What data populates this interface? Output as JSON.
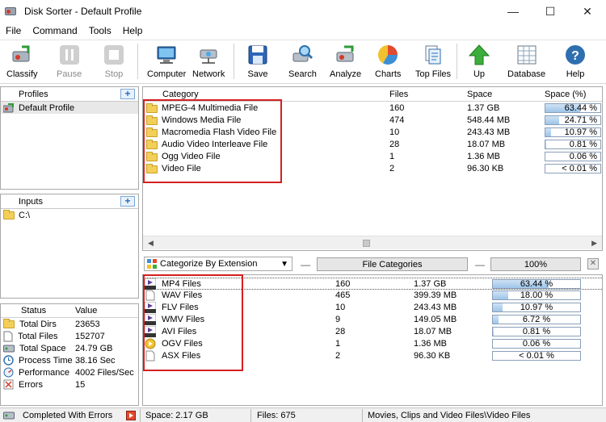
{
  "window": {
    "title": "Disk Sorter - Default Profile",
    "minimize": "—",
    "maximize": "☐",
    "close": "✕"
  },
  "menu": [
    "File",
    "Command",
    "Tools",
    "Help"
  ],
  "toolbar": {
    "classify": "Classify",
    "pause": "Pause",
    "stop": "Stop",
    "computer": "Computer",
    "network": "Network",
    "save": "Save",
    "search": "Search",
    "analyze": "Analyze",
    "charts": "Charts",
    "top_files": "Top Files",
    "up": "Up",
    "database": "Database",
    "help": "Help"
  },
  "profiles": {
    "header": "Profiles",
    "plus": "+",
    "items": [
      "Default Profile"
    ]
  },
  "inputs": {
    "header": "Inputs",
    "plus": "+",
    "items": [
      "C:\\"
    ]
  },
  "status": {
    "col_status": "Status",
    "col_value": "Value",
    "rows": [
      {
        "label": "Total Dirs",
        "value": "23653"
      },
      {
        "label": "Total Files",
        "value": "152707"
      },
      {
        "label": "Total Space",
        "value": "24.79 GB"
      },
      {
        "label": "Process Time",
        "value": "38.16 Sec"
      },
      {
        "label": "Performance",
        "value": "4002 Files/Sec"
      },
      {
        "label": "Errors",
        "value": "15"
      }
    ]
  },
  "top_grid": {
    "col_category": "Category",
    "col_files": "Files",
    "col_space": "Space",
    "col_space_pct": "Space (%)",
    "rows": [
      {
        "name": "MPEG-4 Multimedia File",
        "files": "160",
        "space": "1.37 GB",
        "pct_text": "63.44 %",
        "pct": 63.44
      },
      {
        "name": "Windows Media File",
        "files": "474",
        "space": "548.44 MB",
        "pct_text": "24.71 %",
        "pct": 24.71
      },
      {
        "name": "Macromedia Flash Video File",
        "files": "10",
        "space": "243.43 MB",
        "pct_text": "10.97 %",
        "pct": 10.97
      },
      {
        "name": "Audio Video Interleave File",
        "files": "28",
        "space": "18.07 MB",
        "pct_text": "0.81 %",
        "pct": 0.81
      },
      {
        "name": "Ogg Video File",
        "files": "1",
        "space": "1.36 MB",
        "pct_text": "0.06 %",
        "pct": 0.06
      },
      {
        "name": "Video File",
        "files": "2",
        "space": "96.30 KB",
        "pct_text": "< 0.01 %",
        "pct": 0.01
      }
    ]
  },
  "catbar": {
    "combo": "Categorize By Extension",
    "file_categories": "File Categories",
    "pct": "100%",
    "close": "✕"
  },
  "bottom_grid": {
    "rows": [
      {
        "name": "MP4 Files",
        "badge": "MP4",
        "files": "160",
        "space": "1.37 GB",
        "pct_text": "63.44 %",
        "pct": 63.44
      },
      {
        "name": "WAV Files",
        "badge": "",
        "files": "465",
        "space": "399.39 MB",
        "pct_text": "18.00 %",
        "pct": 18.0
      },
      {
        "name": "FLV Files",
        "badge": "FLV",
        "files": "10",
        "space": "243.43 MB",
        "pct_text": "10.97 %",
        "pct": 10.97
      },
      {
        "name": "WMV Files",
        "badge": "WMV",
        "files": "9",
        "space": "149.05 MB",
        "pct_text": "6.72 %",
        "pct": 6.72
      },
      {
        "name": "AVI Files",
        "badge": "AVI",
        "files": "28",
        "space": "18.07 MB",
        "pct_text": "0.81 %",
        "pct": 0.81
      },
      {
        "name": "OGV Files",
        "badge": "",
        "files": "1",
        "space": "1.36 MB",
        "pct_text": "0.06 %",
        "pct": 0.06
      },
      {
        "name": "ASX Files",
        "badge": "",
        "files": "2",
        "space": "96.30 KB",
        "pct_text": "< 0.01 %",
        "pct": 0.01
      }
    ]
  },
  "statusbar": {
    "state": "Completed With Errors",
    "space": "Space: 2.17 GB",
    "files": "Files: 675",
    "path": "Movies, Clips and Video Files\\Video Files"
  },
  "colors": {
    "highlight_box": "#d42020",
    "bar_fill": "#9ec4e8",
    "folder": "#f3cf5a"
  }
}
